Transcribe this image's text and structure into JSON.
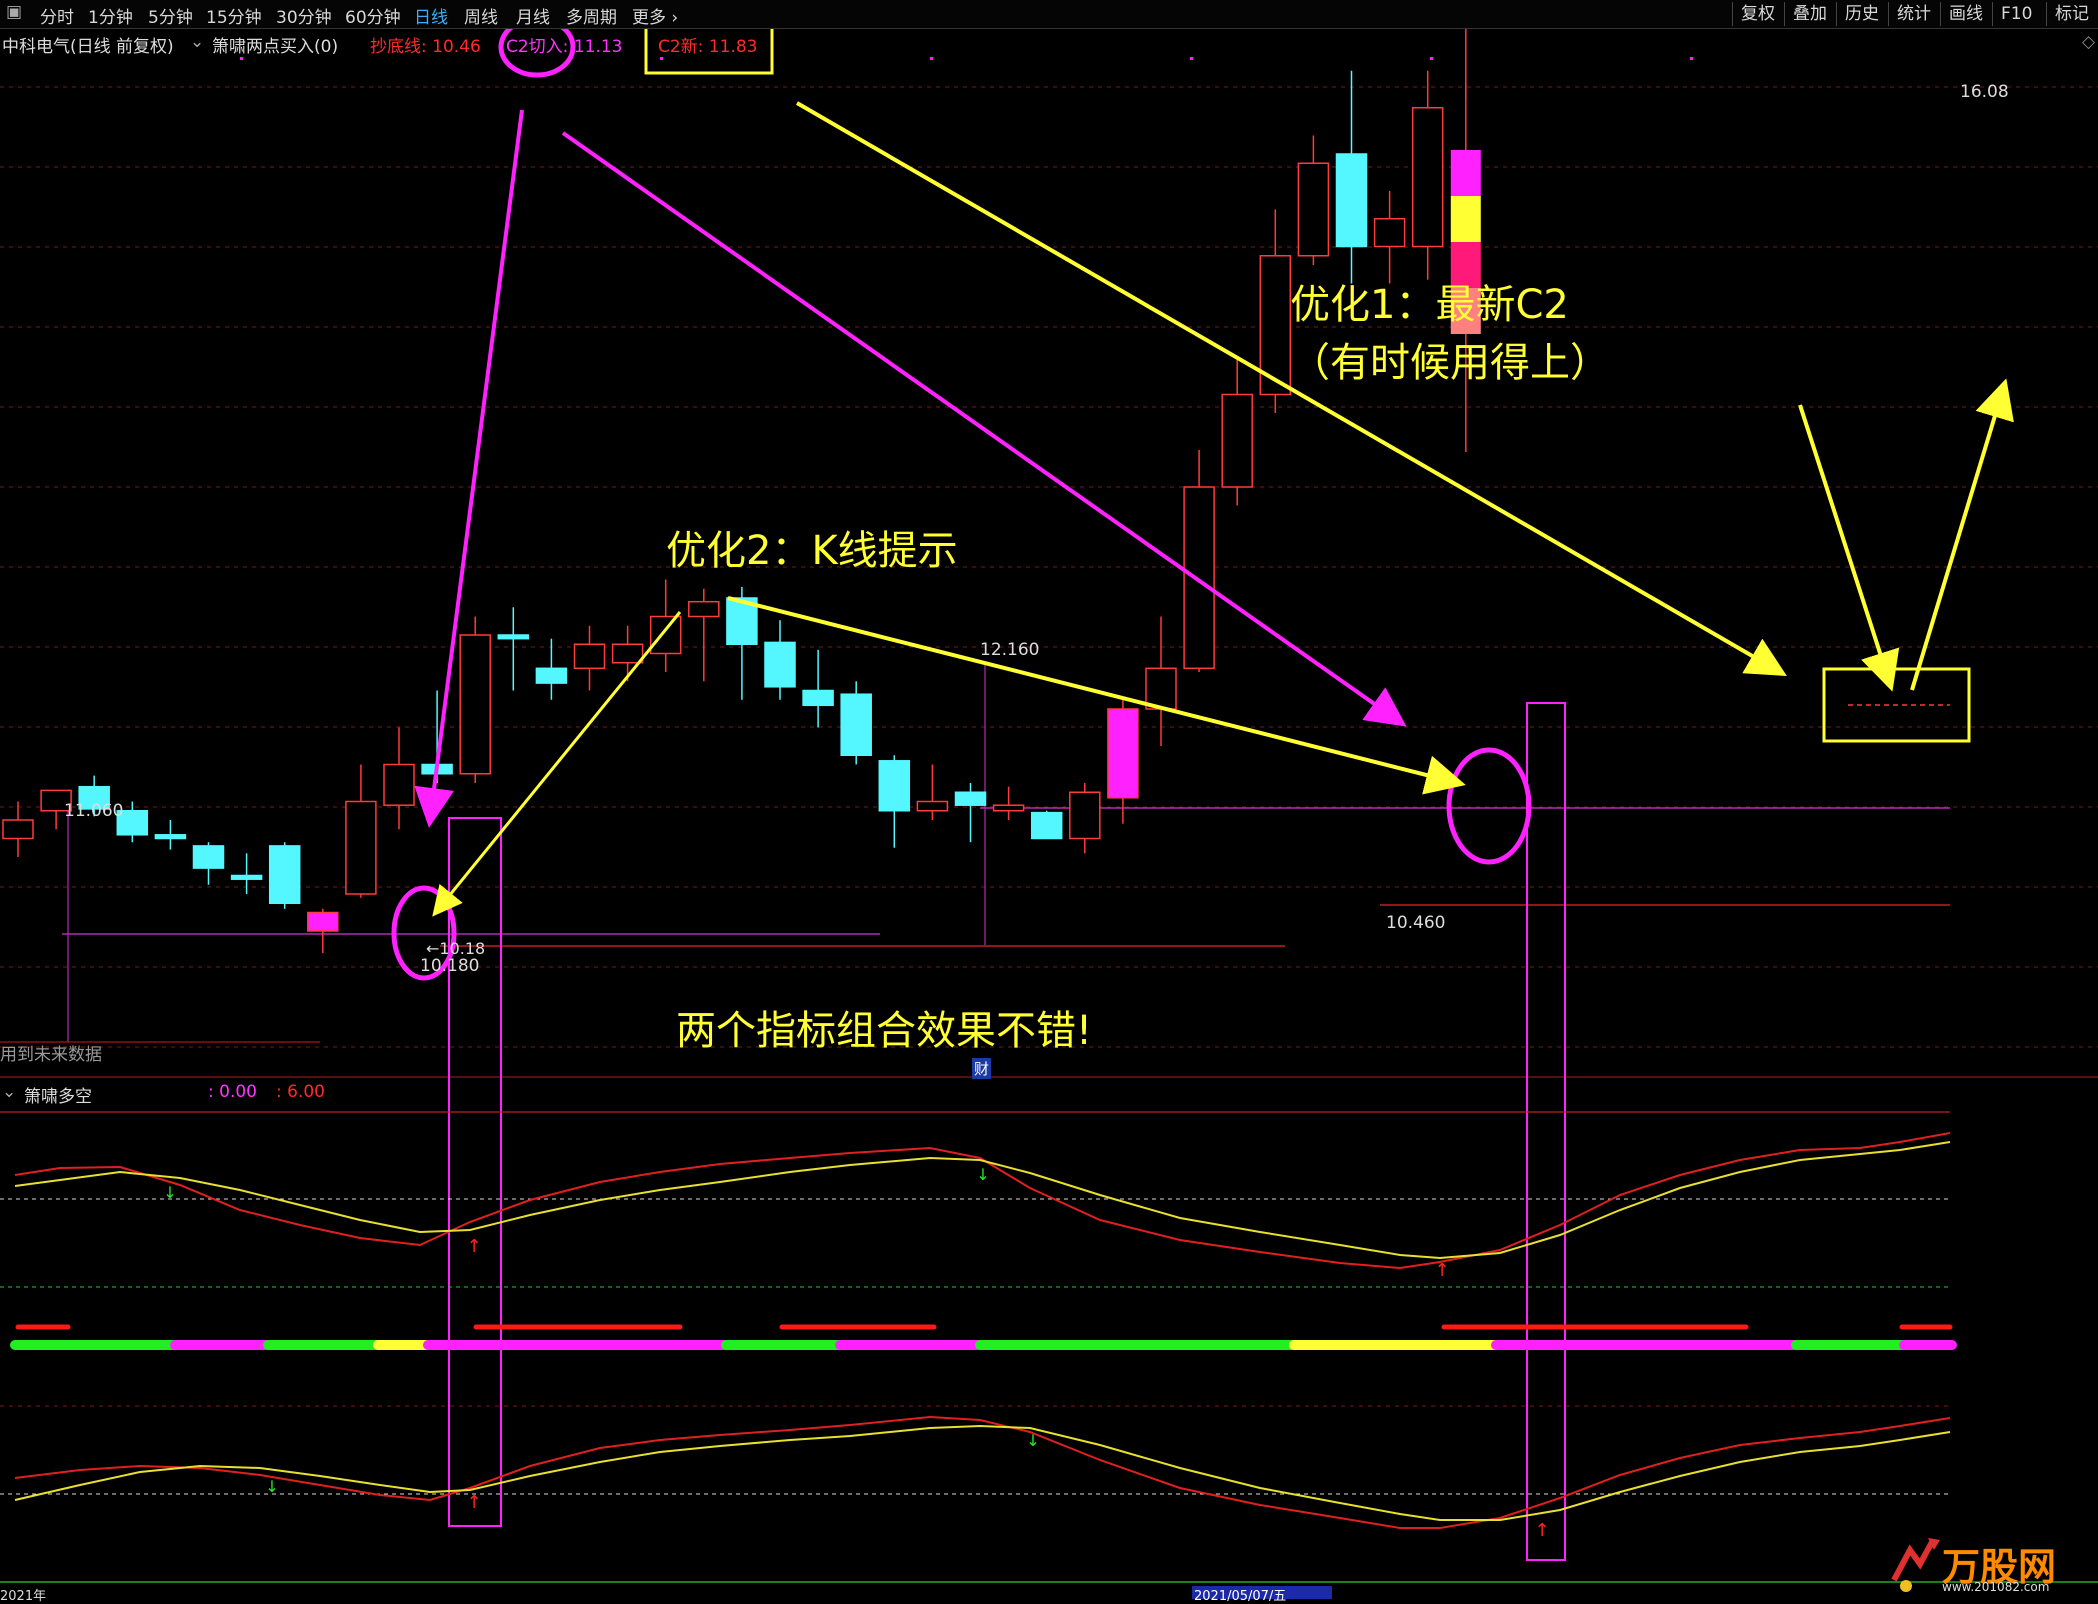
{
  "toolbar": {
    "periods": [
      "分时",
      "1分钟",
      "5分钟",
      "15分钟",
      "30分钟",
      "60分钟",
      "日线",
      "周线",
      "月线",
      "多周期",
      "更多"
    ],
    "active_period": "日线",
    "right_buttons": [
      "复权",
      "叠加",
      "历史",
      "统计",
      "画线",
      "F10",
      "标记"
    ]
  },
  "info": {
    "stock": "中科电气(日线 前复权)",
    "indicator": "箫啸两点买入(0)",
    "bottom_line": "抄底线: 10.46",
    "c2_entry": "C2切入: 11.13",
    "c2_new": "C2新: 11.83"
  },
  "price_labels": {
    "high_left": "11.060",
    "low_left": "10.180",
    "low_left_arrow": "←10.18",
    "mid_high": "12.160",
    "mid_low": "10.460",
    "top_high": "16.08",
    "future_data": "用到未来数据",
    "fin_marker": "财"
  },
  "annotations": {
    "opt1_line1": "优化1：最新C2",
    "opt1_line2": "（有时候用得上）",
    "opt2": "优化2：K线提示",
    "combo": "两个指标组合效果不错!"
  },
  "sub_indicator": {
    "name": "箫啸多空",
    "v1": ": 0.00",
    "v2": ": 6.00"
  },
  "watermark": {
    "text": "万股网",
    "url": "www.201082.com"
  },
  "bottom_dates": [
    "2021年",
    "2021/05/07/五"
  ],
  "colors": {
    "up": "#ff3b3b",
    "down": "#54f7ff",
    "magenta": "#ff22ff",
    "yellow": "#ffff33",
    "green": "#22ee22"
  },
  "chart_data": {
    "type": "candlestick",
    "candles": [
      {
        "o": 10.8,
        "c": 10.9,
        "h": 11.0,
        "l": 10.7
      },
      {
        "o": 10.95,
        "c": 11.06,
        "h": 11.06,
        "l": 10.85
      },
      {
        "o": 11.08,
        "c": 10.96,
        "h": 11.14,
        "l": 10.92
      },
      {
        "o": 10.95,
        "c": 10.82,
        "h": 11.0,
        "l": 10.78
      },
      {
        "o": 10.82,
        "c": 10.8,
        "h": 10.9,
        "l": 10.74
      },
      {
        "o": 10.76,
        "c": 10.64,
        "h": 10.78,
        "l": 10.55
      },
      {
        "o": 10.6,
        "c": 10.58,
        "h": 10.72,
        "l": 10.5
      },
      {
        "o": 10.76,
        "c": 10.45,
        "h": 10.78,
        "l": 10.42
      },
      {
        "o": 10.4,
        "c": 10.3,
        "h": 10.42,
        "l": 10.18
      },
      {
        "o": 10.5,
        "c": 11.0,
        "h": 11.2,
        "l": 10.48
      },
      {
        "o": 10.98,
        "c": 11.2,
        "h": 11.4,
        "l": 10.85
      },
      {
        "o": 11.2,
        "c": 11.15,
        "h": 11.6,
        "l": 11.1
      },
      {
        "o": 11.15,
        "c": 11.9,
        "h": 12.0,
        "l": 11.1
      },
      {
        "o": 11.9,
        "c": 11.88,
        "h": 12.05,
        "l": 11.6
      },
      {
        "o": 11.72,
        "c": 11.64,
        "h": 11.88,
        "l": 11.55
      },
      {
        "o": 11.72,
        "c": 11.85,
        "h": 11.95,
        "l": 11.6
      },
      {
        "o": 11.75,
        "c": 11.85,
        "h": 11.95,
        "l": 11.65
      },
      {
        "o": 11.8,
        "c": 12.0,
        "h": 12.2,
        "l": 11.7
      },
      {
        "o": 12.0,
        "c": 12.08,
        "h": 12.15,
        "l": 11.65
      },
      {
        "o": 12.1,
        "c": 11.85,
        "h": 12.16,
        "l": 11.55
      },
      {
        "o": 11.86,
        "c": 11.62,
        "h": 11.98,
        "l": 11.55
      },
      {
        "o": 11.6,
        "c": 11.52,
        "h": 11.82,
        "l": 11.4
      },
      {
        "o": 11.58,
        "c": 11.25,
        "h": 11.65,
        "l": 11.2
      },
      {
        "o": 11.22,
        "c": 10.95,
        "h": 11.25,
        "l": 10.75
      },
      {
        "o": 10.95,
        "c": 11.0,
        "h": 11.2,
        "l": 10.9
      },
      {
        "o": 11.05,
        "c": 10.98,
        "h": 11.1,
        "l": 10.78
      },
      {
        "o": 10.95,
        "c": 10.98,
        "h": 11.08,
        "l": 10.9
      },
      {
        "o": 10.94,
        "c": 10.8,
        "h": 10.95,
        "l": 10.8
      },
      {
        "o": 10.8,
        "c": 11.05,
        "h": 11.1,
        "l": 10.72
      },
      {
        "o": 11.02,
        "c": 11.5,
        "h": 11.55,
        "l": 10.88
      },
      {
        "o": 11.5,
        "c": 11.72,
        "h": 12.0,
        "l": 11.3
      },
      {
        "o": 11.72,
        "c": 12.7,
        "h": 12.9,
        "l": 11.7
      },
      {
        "o": 12.7,
        "c": 13.2,
        "h": 13.4,
        "l": 12.6
      },
      {
        "o": 13.2,
        "c": 13.95,
        "h": 14.2,
        "l": 13.1
      },
      {
        "o": 13.95,
        "c": 14.45,
        "h": 14.6,
        "l": 13.9
      },
      {
        "o": 14.5,
        "c": 14.0,
        "h": 14.95,
        "l": 13.8
      },
      {
        "o": 14.0,
        "c": 14.15,
        "h": 14.3,
        "l": 13.8
      },
      {
        "o": 14.0,
        "c": 14.75,
        "h": 14.95,
        "l": 13.82
      },
      {
        "o": 15.25,
        "c": 15.9,
        "h": 16.08,
        "l": 14.8
      }
    ]
  }
}
